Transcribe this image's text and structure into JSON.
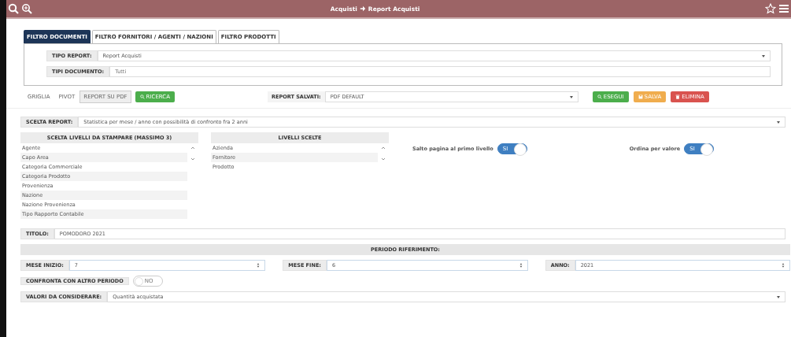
{
  "header": {
    "section": "Acquisti",
    "page": "Report Acquisti"
  },
  "tabs": [
    {
      "label": "FILTRO DOCUMENTI",
      "selected": true
    },
    {
      "label": "FILTRO FORNITORI / AGENTI / NAZIONI",
      "selected": false
    },
    {
      "label": "FILTRO PRODOTTI",
      "selected": false
    }
  ],
  "report_type": {
    "label": "TIPO REPORT:",
    "value": "Report Acquisti"
  },
  "document_types": {
    "label": "TIPI DOCUMENTO:",
    "placeholder": "Tutti"
  },
  "output_modes": [
    {
      "label": "GRIGLIA",
      "selected": false
    },
    {
      "label": "PIVOT",
      "selected": false
    },
    {
      "label": "REPORT SU PDF",
      "selected": true
    }
  ],
  "search_button": "RICERCA",
  "saved_reports": {
    "label": "REPORT SALVATI:",
    "value": "PDF DEFAULT"
  },
  "actions": [
    {
      "label": "ESEGUI",
      "kind": "run"
    },
    {
      "label": "SALVA",
      "kind": "save"
    },
    {
      "label": "ELIMINA",
      "kind": "delete"
    }
  ],
  "report_choice": {
    "label": "SCELTA REPORT:",
    "value": "Statistica per mese / anno con possibilità di confronto fra 2 anni"
  },
  "available_levels": {
    "title": "SCELTA LIVELLI DA STAMPARE (MASSIMO 3)",
    "items": [
      "Agente",
      "Capo Area",
      "Categoria Commerciale",
      "Categoria Prodotto",
      "Provenienza",
      "Nazione",
      "Nazione Provenienza",
      "Tipo Rapporto Contabile"
    ]
  },
  "chosen_levels": {
    "title": "LIVELLI SCELTE",
    "items": [
      "Azienda",
      "Fornitore",
      "Prodotto"
    ]
  },
  "toggles": [
    {
      "label": "Salto pagina al primo livello",
      "text": "SI",
      "on": true
    },
    {
      "label": "Ordina per valore",
      "text": "SI",
      "on": true
    }
  ],
  "title_field": {
    "label": "TITOLO:",
    "value": "POMODORO 2021"
  },
  "period": {
    "title": "PERIODO RIFERIMENTO:",
    "fields": [
      {
        "label": "MESE INIZIO:",
        "value": "7"
      },
      {
        "label": "MESE FINE:",
        "value": "6"
      },
      {
        "label": "ANNO:",
        "value": "2021"
      }
    ]
  },
  "compare": {
    "label": "CONFRONTA CON ALTRO PERIODO",
    "text": "NO",
    "on": false
  },
  "values_field": {
    "label": "VALORI DA CONSIDERARE:",
    "value": "Quantità acquistata"
  }
}
